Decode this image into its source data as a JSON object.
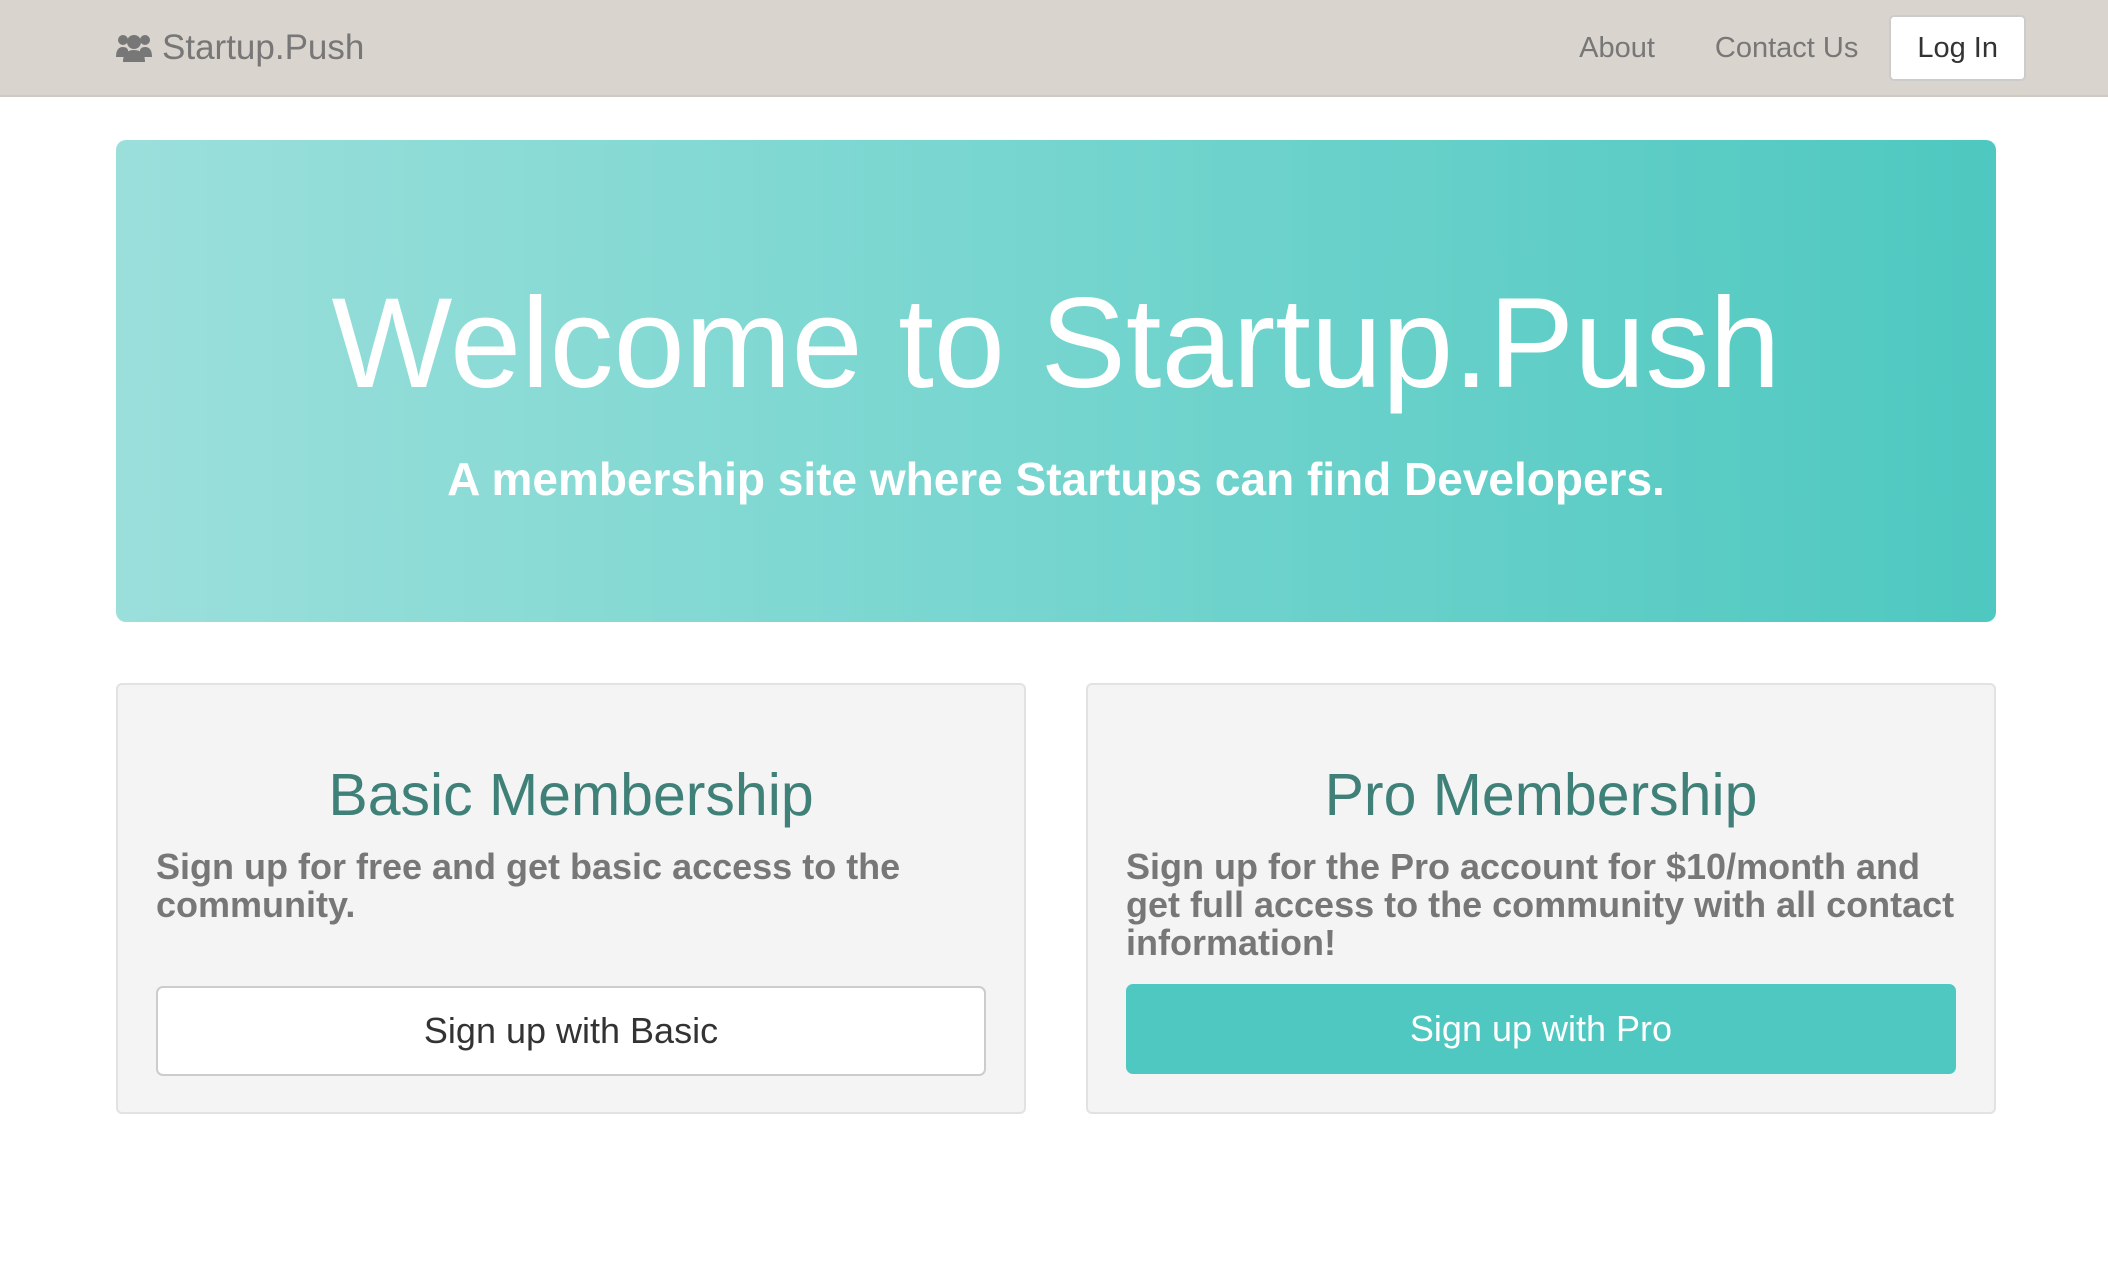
{
  "navbar": {
    "brand_icon": "users-icon",
    "brand_label": "Startup.Push",
    "links": [
      {
        "label": "About"
      },
      {
        "label": "Contact Us"
      }
    ],
    "login_label": "Log In"
  },
  "hero": {
    "title": "Welcome to Startup.Push",
    "subtitle": "A membership site where Startups can find Developers."
  },
  "plans": {
    "basic": {
      "title": "Basic Membership",
      "description": "Sign up for free and get basic access to the community.",
      "button_label": "Sign up with Basic"
    },
    "pro": {
      "title": "Pro Membership",
      "description": "Sign up for the Pro account for $10/month and get full access to the community with all contact information!",
      "button_label": "Sign up with Pro"
    }
  },
  "colors": {
    "navbar_bg": "#d9d4ce",
    "accent": "#4ec8c0",
    "heading_teal": "#3f8178",
    "muted_text": "#777777"
  }
}
